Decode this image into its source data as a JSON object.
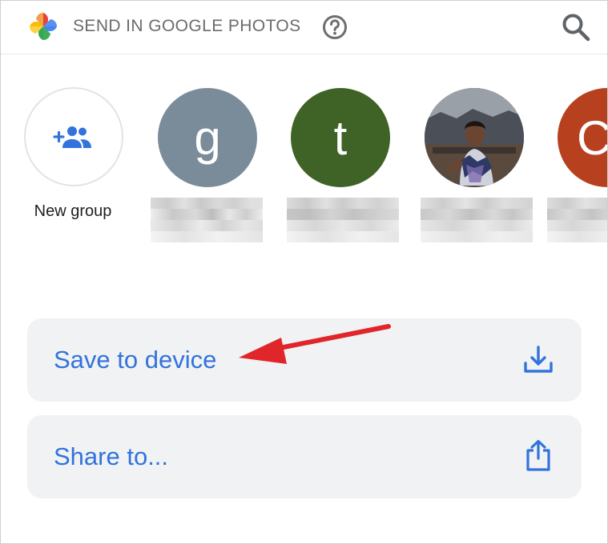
{
  "header": {
    "title": "SEND IN GOOGLE PHOTOS",
    "logo_icon": "google-photos-pinwheel-icon",
    "help_icon": "help-circle-icon",
    "search_icon": "search-icon"
  },
  "contacts": {
    "new_group": {
      "label": "New group",
      "icon": "add-group-icon"
    },
    "people": [
      {
        "initial": "g",
        "color": "#7a8c9a"
      },
      {
        "initial": "t",
        "color": "#3f6326"
      },
      {
        "initial": "",
        "color": "#6b6f79",
        "photo": true
      },
      {
        "initial": "C",
        "color": "#b7401f"
      }
    ]
  },
  "options": {
    "save": {
      "label": "Save to device",
      "icon": "download-icon"
    },
    "share": {
      "label": "Share to...",
      "icon": "share-icon"
    }
  },
  "colors": {
    "accent": "#3273dc",
    "card_bg": "#f1f2f4",
    "annotation_arrow": "#e0262a"
  }
}
